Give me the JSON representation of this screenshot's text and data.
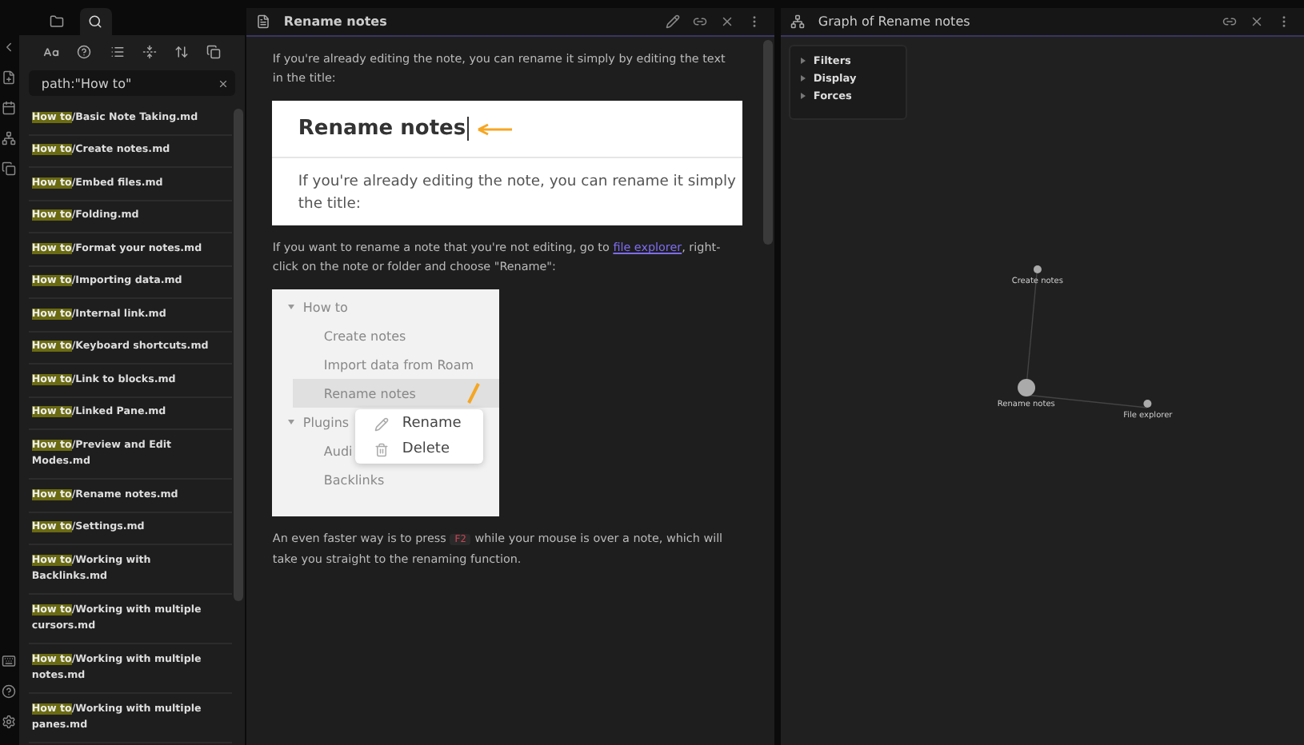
{
  "sidebar": {
    "tabs": [
      {
        "kind": "folder",
        "selected": false
      },
      {
        "kind": "search",
        "selected": true
      }
    ],
    "search": {
      "value": "path:\"How to\""
    },
    "results": [
      {
        "match": "How to",
        "rest": "/Basic Note Taking.md"
      },
      {
        "match": "How to",
        "rest": "/Create notes.md"
      },
      {
        "match": "How to",
        "rest": "/Embed files.md"
      },
      {
        "match": "How to",
        "rest": "/Folding.md"
      },
      {
        "match": "How to",
        "rest": "/Format your notes.md"
      },
      {
        "match": "How to",
        "rest": "/Importing data.md"
      },
      {
        "match": "How to",
        "rest": "/Internal link.md"
      },
      {
        "match": "How to",
        "rest": "/Keyboard shortcuts.md"
      },
      {
        "match": "How to",
        "rest": "/Link to blocks.md"
      },
      {
        "match": "How to",
        "rest": "/Linked Pane.md"
      },
      {
        "match": "How to",
        "rest": "/Preview and Edit Modes.md"
      },
      {
        "match": "How to",
        "rest": "/Rename notes.md"
      },
      {
        "match": "How to",
        "rest": "/Settings.md"
      },
      {
        "match": "How to",
        "rest": "/Working with Backlinks.md"
      },
      {
        "match": "How to",
        "rest": "/Working with multiple cursors.md"
      },
      {
        "match": "How to",
        "rest": "/Working with multiple notes.md"
      },
      {
        "match": "How to",
        "rest": "/Working with multiple panes.md"
      }
    ]
  },
  "note": {
    "title": "Rename notes",
    "blocks": [
      {
        "kind": "paragraph",
        "parts": [
          {
            "kind": "text",
            "text": "If you're already editing the note, you can rename it simply by editing the text in the title:"
          }
        ]
      },
      {
        "kind": "title_shot",
        "heading": "Rename notes",
        "lines": [
          "If you're already editing the note, you can rename it simply",
          "the title:"
        ]
      },
      {
        "kind": "paragraph",
        "parts": [
          {
            "kind": "text",
            "text": "If you want to rename a note that you're not editing, go to "
          },
          {
            "kind": "link",
            "text": "file explorer"
          },
          {
            "kind": "text",
            "text": ", right-click on the note or folder and choose \"Rename\":"
          }
        ]
      },
      {
        "kind": "menu_shot",
        "tree": [
          {
            "label": "How to",
            "expanded": true,
            "children": [
              {
                "label": "Create notes",
                "selected": false
              },
              {
                "label": "Import data from Roam",
                "selected": false
              },
              {
                "label": "Rename notes",
                "selected": true
              }
            ]
          },
          {
            "label": "Plugins",
            "expanded": true,
            "children": [
              {
                "label": "Audi",
                "selected": false
              },
              {
                "label": "Backlinks",
                "selected": false
              }
            ]
          }
        ],
        "menu": [
          {
            "kind": "pencil",
            "label": "Rename"
          },
          {
            "kind": "trash",
            "label": "Delete"
          }
        ]
      },
      {
        "kind": "paragraph",
        "parts": [
          {
            "kind": "text",
            "text": "An even faster way is to press "
          },
          {
            "kind": "key",
            "text": "F2"
          },
          {
            "kind": "text",
            "text": " while your mouse is over a note, which will take you straight to the renaming function."
          }
        ]
      }
    ]
  },
  "graph": {
    "title": "Graph of Rename notes",
    "controls": [
      {
        "label": "Filters",
        "expanded": false
      },
      {
        "label": "Display",
        "expanded": false
      },
      {
        "label": "Forces",
        "expanded": false
      }
    ],
    "nodes": [
      {
        "label": "Create notes"
      },
      {
        "label": "Rename notes"
      },
      {
        "label": "File explorer"
      }
    ]
  }
}
